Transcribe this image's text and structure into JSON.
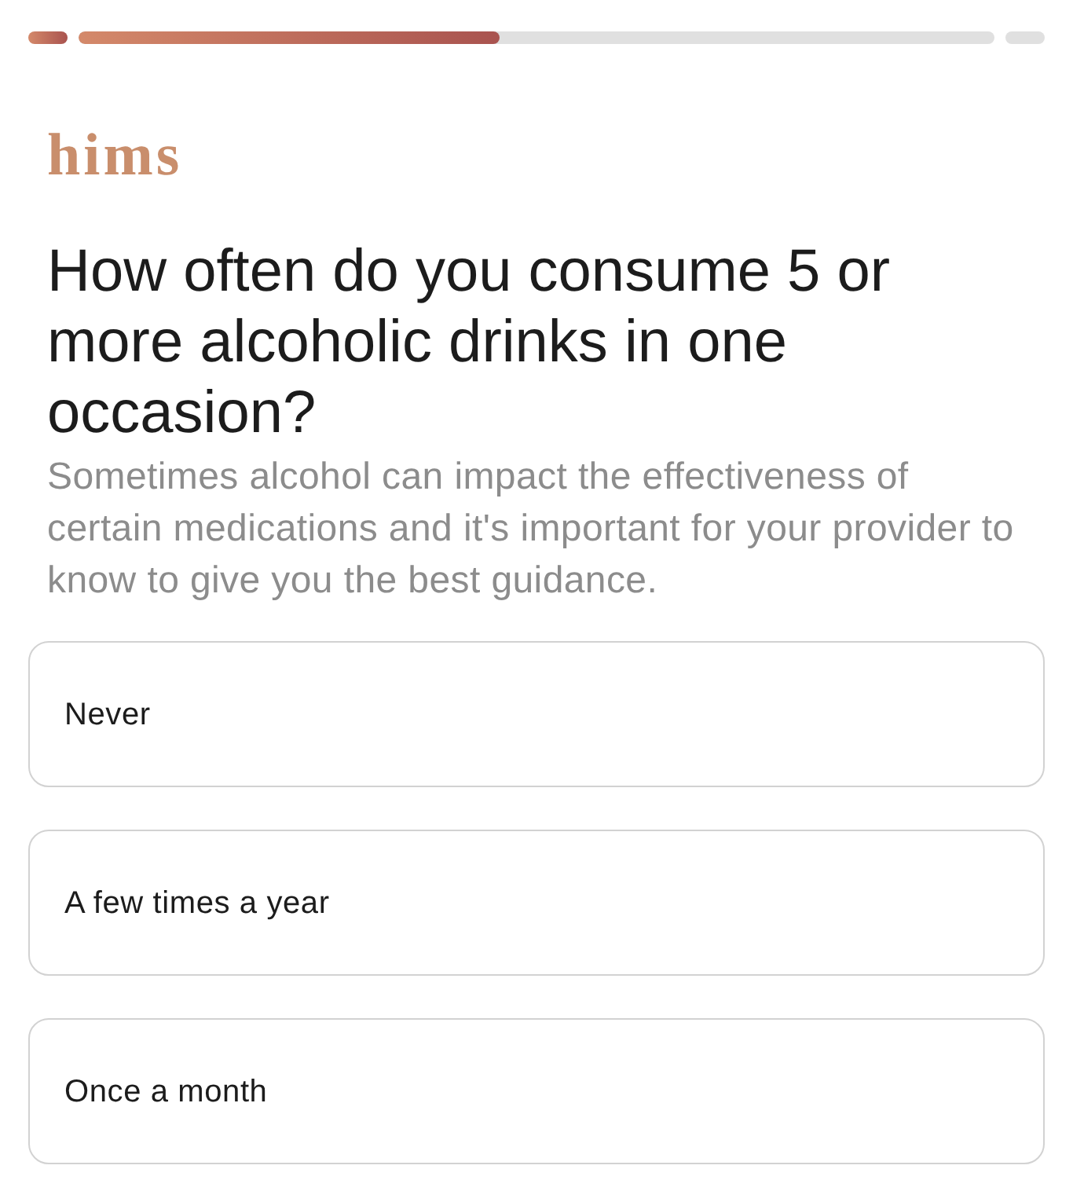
{
  "progress": {
    "segments": [
      {
        "completed": true
      },
      {
        "completed": false,
        "level": 0.46
      },
      {
        "completed": false
      }
    ]
  },
  "logo": "hims",
  "question": {
    "title": "How often do you consume 5 or more alcoholic drinks in one occasion?",
    "description": "Sometimes alcohol can impact the effectiveness of certain medications and it's important for your provider to know to give you the best guidance."
  },
  "options": [
    {
      "label": "Never",
      "selected": false
    },
    {
      "label": "A few times a year",
      "selected": false
    },
    {
      "label": "Once a month",
      "selected": false
    }
  ]
}
